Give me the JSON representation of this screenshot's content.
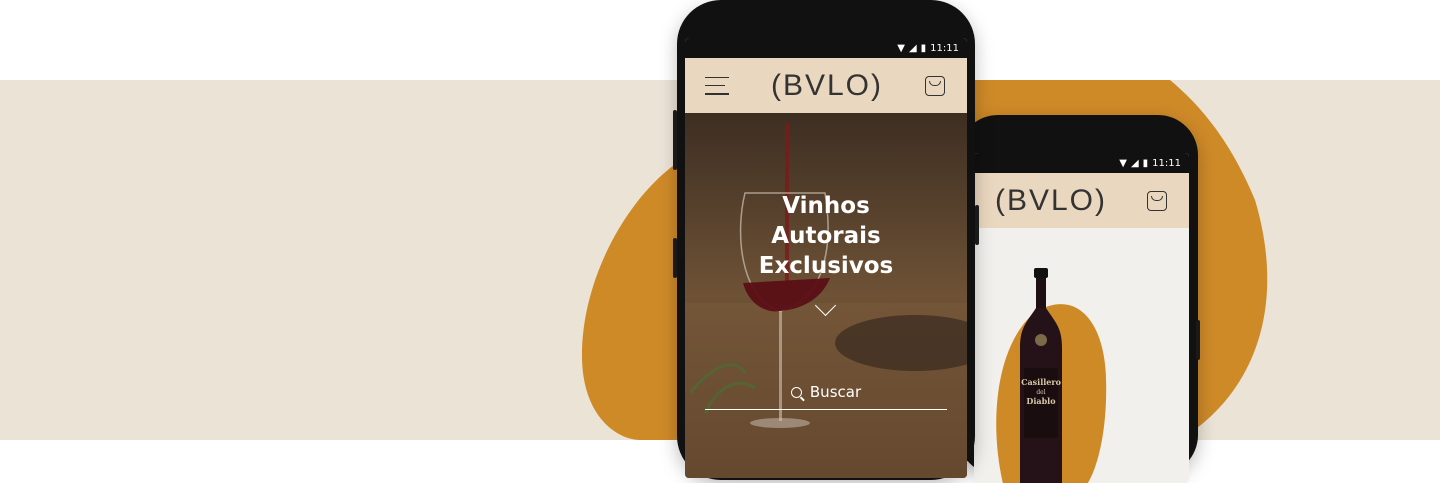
{
  "colors": {
    "background_band": "#ebe4d6",
    "accent_blob": "#cf8a28",
    "app_bar": "#ead7bf"
  },
  "front_phone": {
    "status_time": "11:11",
    "brand": "(BVLO)",
    "hero_title_lines": [
      "Vinhos",
      "Autorais",
      "Exclusivos"
    ],
    "search_label": "Buscar",
    "icons": [
      "menu-icon",
      "shopping-bag-icon",
      "chevron-down-icon",
      "search-icon"
    ]
  },
  "back_phone": {
    "status_time": "11:11",
    "brand": "(BVLO)",
    "product_label_lines": [
      "Casillero",
      "del",
      "Diablo"
    ],
    "icons": [
      "shopping-bag-icon"
    ]
  }
}
